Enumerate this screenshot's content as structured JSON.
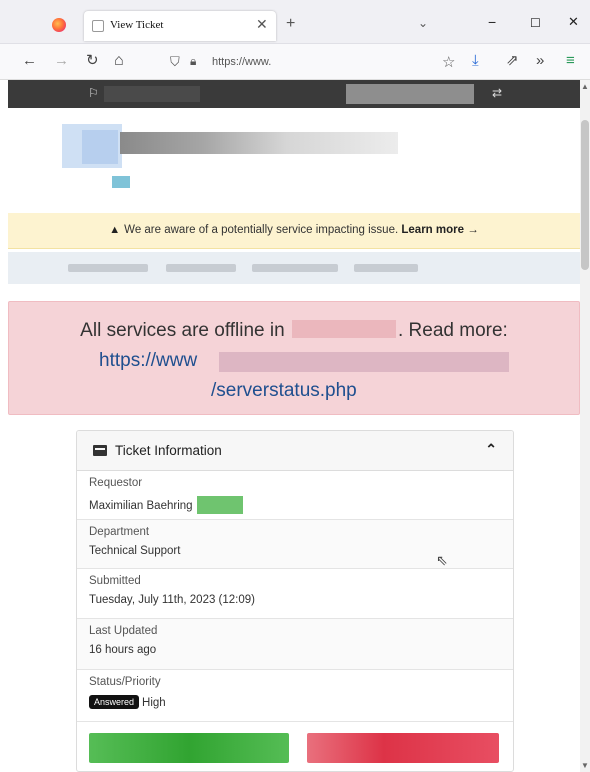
{
  "browser": {
    "tab_title": "View Ticket",
    "tab_close": "✕",
    "new_tab": "+",
    "tab_list": "⌄",
    "minimize": "−",
    "maximize": "☐",
    "close": "✕",
    "back": "←",
    "forward": "→",
    "reload": "↻",
    "home": "⌂",
    "url_prefix": "https://www.",
    "bookmark": "☆",
    "downloads": "⤓",
    "extensions": "⇗",
    "overflow": "»",
    "menu": "≡"
  },
  "site": {
    "topbar_flag": "⚐",
    "topbar_shuffle": "⇄",
    "notice_icon": "▲",
    "notice_text": "We are aware of a potentially service impacting issue.",
    "notice_link": "Learn more →"
  },
  "outage": {
    "text_before": "All services are offline in",
    "text_after": ". Read more:",
    "link_start": "https://www",
    "link_end": "/serverstatus.php"
  },
  "ticket": {
    "header": "Ticket Information",
    "collapse_icon": "⌃",
    "fields": {
      "requestor_label": "Requestor",
      "requestor_value": "Maximilian Baehring",
      "department_label": "Department",
      "department_value": "Technical Support",
      "submitted_label": "Submitted",
      "submitted_value": "Tuesday, July 11th, 2023 (12:09)",
      "updated_label": "Last Updated",
      "updated_value": "16 hours ago",
      "status_label": "Status/Priority",
      "status_badge": "Answered",
      "priority_value": "High"
    }
  },
  "colors": {
    "notice_bg": "#fdf3d0",
    "outage_bg": "#f5d3d7",
    "link": "#1f4f8f",
    "reply_button": "#31a431",
    "close_button": "#dd3347"
  }
}
